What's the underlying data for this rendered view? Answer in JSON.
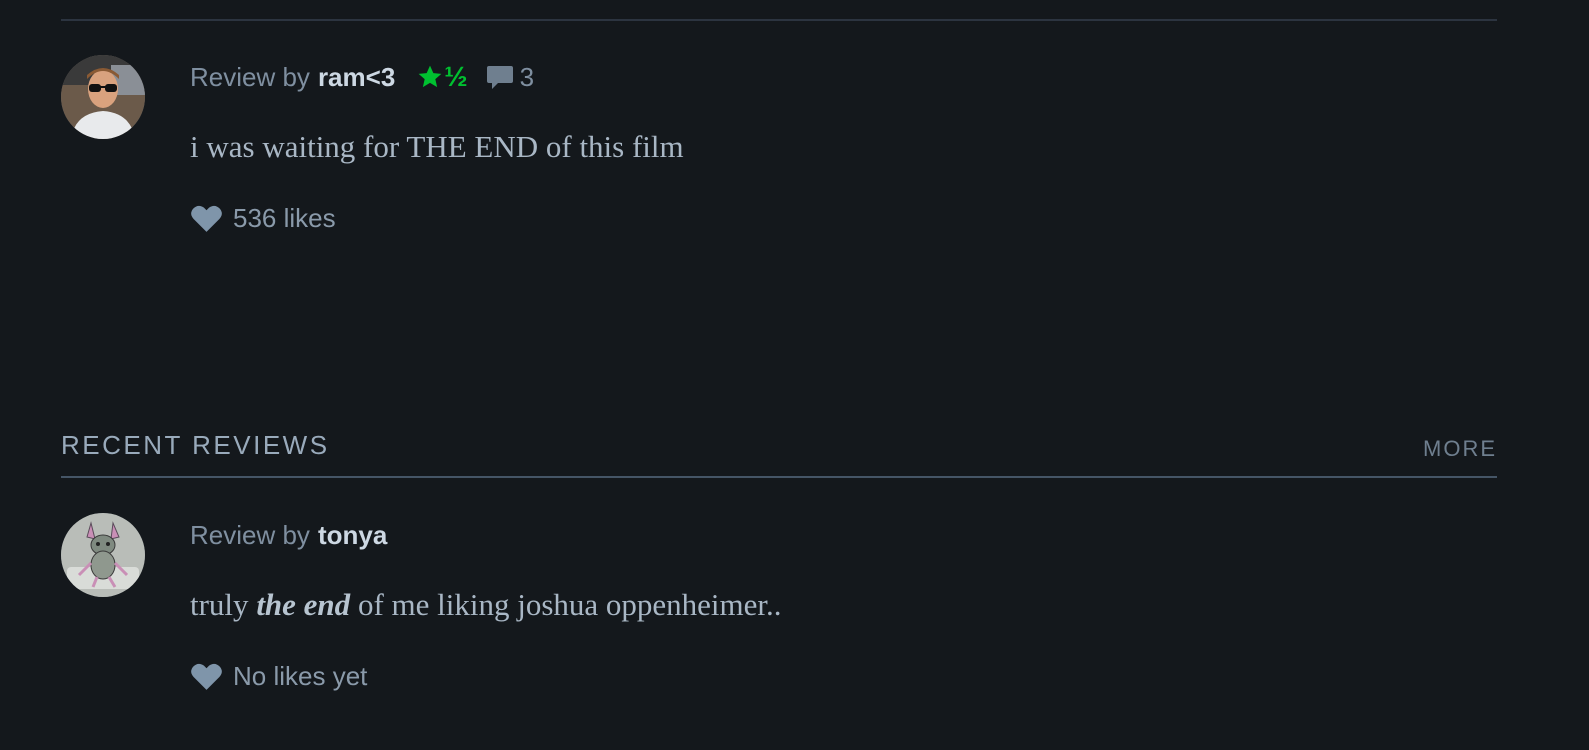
{
  "reviews_top": {
    "review": {
      "prefix": "Review by",
      "username": "ram<3",
      "rating_text": "½",
      "comment_count": "3",
      "text": "i was waiting for THE END of this film",
      "likes": "536 likes"
    }
  },
  "recent_reviews": {
    "title": "RECENT REVIEWS",
    "more_label": "MORE",
    "review": {
      "prefix": "Review by",
      "username": "tonya",
      "text_before": "truly ",
      "text_emphasis": "the end",
      "text_after": " of me liking joshua oppenheimer..",
      "likes": "No likes yet"
    }
  },
  "icons": {
    "rating": "star-icon",
    "comments": "speech-bubble-icon",
    "likes": "heart-icon"
  },
  "colors": {
    "background": "#14181c",
    "rating_green": "#00c030",
    "username": "#cdd8e3",
    "muted_text": "#7f8fa0"
  }
}
